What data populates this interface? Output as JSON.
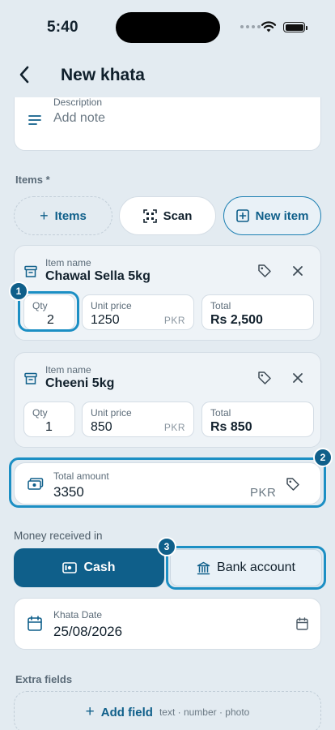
{
  "status_bar": {
    "time": "5:40"
  },
  "header": {
    "title": "New khata"
  },
  "description": {
    "label": "Description",
    "placeholder": "Add note"
  },
  "items_section": {
    "label": "Items *",
    "add_items_label": "Items",
    "scan_label": "Scan",
    "new_item_label": "New item"
  },
  "items": [
    {
      "name_label": "Item name",
      "name": "Chawal Sella 5kg",
      "qty_label": "Qty",
      "qty": "2",
      "unit_price_label": "Unit price",
      "unit_price": "1250",
      "currency": "PKR",
      "total_label": "Total",
      "total": "Rs 2,500"
    },
    {
      "name_label": "Item name",
      "name": "Cheeni 5kg",
      "qty_label": "Qty",
      "qty": "1",
      "unit_price_label": "Unit price",
      "unit_price": "850",
      "currency": "PKR",
      "total_label": "Total",
      "total": "Rs 850"
    }
  ],
  "total_amount": {
    "label": "Total amount",
    "value": "3350",
    "currency": "PKR"
  },
  "money_received": {
    "label": "Money received in",
    "options": [
      "Cash",
      "Bank account"
    ],
    "selected": "Cash"
  },
  "khata_date": {
    "label": "Khata Date",
    "value": "25/08/2026"
  },
  "extra_fields": {
    "label": "Extra fields",
    "add_label": "Add field",
    "hint": "text · number · photo"
  },
  "annotations": {
    "badges": [
      "1",
      "2",
      "3"
    ]
  },
  "colors": {
    "primary": "#0f5f8a",
    "highlight": "#1c8fc4",
    "background": "#e3ebf1"
  }
}
